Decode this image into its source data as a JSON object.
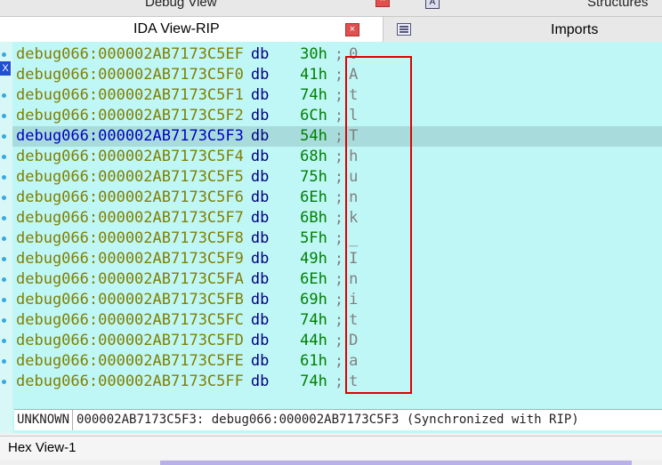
{
  "top_tabs": {
    "debug_view": "Debug View",
    "structures": "Structures"
  },
  "tabs": {
    "active": "IDA View-RIP",
    "imports": "Imports"
  },
  "listing": [
    {
      "addr": "debug066:000002AB7173C5EF",
      "op": "db",
      "val": "30h",
      "cmt": "0"
    },
    {
      "addr": "debug066:000002AB7173C5F0",
      "op": "db",
      "val": "41h",
      "cmt": "A"
    },
    {
      "addr": "debug066:000002AB7173C5F1",
      "op": "db",
      "val": "74h",
      "cmt": "t"
    },
    {
      "addr": "debug066:000002AB7173C5F2",
      "op": "db",
      "val": "6Ch",
      "cmt": "l"
    },
    {
      "addr": "debug066:000002AB7173C5F3",
      "op": "db",
      "val": "54h",
      "cmt": "T"
    },
    {
      "addr": "debug066:000002AB7173C5F4",
      "op": "db",
      "val": "68h",
      "cmt": "h"
    },
    {
      "addr": "debug066:000002AB7173C5F5",
      "op": "db",
      "val": "75h",
      "cmt": "u"
    },
    {
      "addr": "debug066:000002AB7173C5F6",
      "op": "db",
      "val": "6Eh",
      "cmt": "n"
    },
    {
      "addr": "debug066:000002AB7173C5F7",
      "op": "db",
      "val": "6Bh",
      "cmt": "k"
    },
    {
      "addr": "debug066:000002AB7173C5F8",
      "op": "db",
      "val": "5Fh",
      "cmt": "_"
    },
    {
      "addr": "debug066:000002AB7173C5F9",
      "op": "db",
      "val": "49h",
      "cmt": "I"
    },
    {
      "addr": "debug066:000002AB7173C5FA",
      "op": "db",
      "val": "6Eh",
      "cmt": "n"
    },
    {
      "addr": "debug066:000002AB7173C5FB",
      "op": "db",
      "val": "69h",
      "cmt": "i"
    },
    {
      "addr": "debug066:000002AB7173C5FC",
      "op": "db",
      "val": "74h",
      "cmt": "t"
    },
    {
      "addr": "debug066:000002AB7173C5FD",
      "op": "db",
      "val": "44h",
      "cmt": "D"
    },
    {
      "addr": "debug066:000002AB7173C5FE",
      "op": "db",
      "val": "61h",
      "cmt": "a"
    },
    {
      "addr": "debug066:000002AB7173C5FF",
      "op": "db",
      "val": "74h",
      "cmt": "t"
    }
  ],
  "current_line": 4,
  "status": {
    "segment": "UNKNOWN",
    "location": "000002AB7173C5F3: debug066:000002AB7173C5F3 (Synchronized with RIP)"
  },
  "bottom_tab": "Hex View-1",
  "colors": {
    "background": "#bff7f7",
    "address": "#808000",
    "current_address": "#0000c0",
    "value": "#008000",
    "annotation": "#e00000"
  }
}
